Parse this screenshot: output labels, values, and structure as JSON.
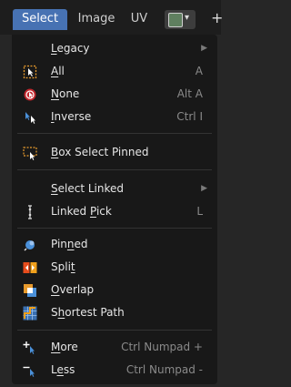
{
  "header": {
    "tabs": [
      {
        "label": "Select",
        "active": true
      },
      {
        "label": "Image",
        "active": false
      },
      {
        "label": "UV",
        "active": false
      }
    ],
    "mode_icon": "uv-editor-mode-icon",
    "plus_label": "+"
  },
  "menu": {
    "items": [
      {
        "key": "legacy",
        "label_u": "L",
        "label_rest": "egacy",
        "shortcut": "",
        "submenu": true,
        "icon": null
      },
      {
        "key": "all",
        "label_u": "A",
        "label_rest": "ll",
        "shortcut": "A",
        "submenu": false,
        "icon": "select-all-icon"
      },
      {
        "key": "none",
        "label_u": "N",
        "label_rest": "one",
        "shortcut": "Alt A",
        "submenu": false,
        "icon": "select-none-icon"
      },
      {
        "key": "inverse",
        "label_u": "I",
        "label_rest": "nverse",
        "shortcut": "Ctrl I",
        "submenu": false,
        "icon": "select-inverse-icon"
      },
      {
        "key": "box-select-pinned",
        "label_u": "B",
        "label_rest": "ox Select Pinned",
        "shortcut": "",
        "submenu": false,
        "icon": "box-select-icon"
      },
      {
        "key": "select-linked",
        "label_u": "S",
        "label_rest": "elect Linked",
        "shortcut": "",
        "submenu": true,
        "icon": null
      },
      {
        "key": "linked-pick",
        "label_pre": "Linked ",
        "label_u": "P",
        "label_rest": "ick",
        "shortcut": "L",
        "submenu": false,
        "icon": "linked-pick-icon"
      },
      {
        "key": "pinned",
        "label_pre": "Pin",
        "label_u": "n",
        "label_rest": "ed",
        "shortcut": "",
        "submenu": false,
        "icon": "pinned-icon"
      },
      {
        "key": "split",
        "label_pre": "Spli",
        "label_u": "t",
        "label_rest": "",
        "shortcut": "",
        "submenu": false,
        "icon": "split-icon"
      },
      {
        "key": "overlap",
        "label_u": "O",
        "label_rest": "verlap",
        "shortcut": "",
        "submenu": false,
        "icon": "overlap-icon"
      },
      {
        "key": "shortest-path",
        "label_pre": "S",
        "label_u": "h",
        "label_rest": "ortest Path",
        "shortcut": "",
        "submenu": false,
        "icon": "shortest-path-icon"
      },
      {
        "key": "more",
        "label_u": "M",
        "label_rest": "ore",
        "shortcut": "Ctrl Numpad +",
        "submenu": false,
        "icon": "select-more-icon"
      },
      {
        "key": "less",
        "label_pre": "L",
        "label_u": "e",
        "label_rest": "ss",
        "shortcut": "Ctrl Numpad -",
        "submenu": false,
        "icon": "select-less-icon"
      }
    ],
    "submenu_arrow": "▶"
  },
  "colors": {
    "accent": "#4772b3",
    "menu_bg": "#181818",
    "header_bg": "#1d1d1d",
    "shortcut_text": "#8a8a8a"
  }
}
